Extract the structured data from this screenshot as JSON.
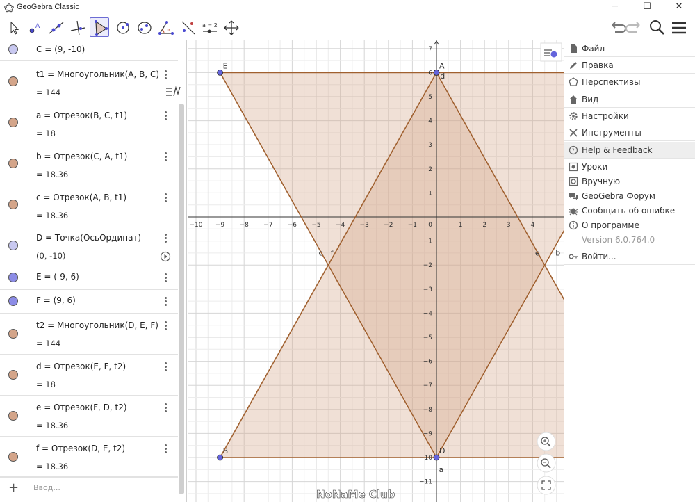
{
  "window": {
    "title": "GeoGebra Classic",
    "minimize": "─",
    "maximize": "☐",
    "close": "✕"
  },
  "toolbar": {
    "tools": [
      "move-tool",
      "point-tool",
      "line-tool",
      "perpendicular-tool",
      "polygon-tool",
      "circle-tool",
      "conic-tool",
      "angle-tool",
      "reflect-tool",
      "slider-tool",
      "move-graphics-tool"
    ],
    "slider_label": "a = 2",
    "active_tool": "polygon-tool"
  },
  "algebra": {
    "rows": [
      {
        "def": "C = (9, -10)",
        "value": "",
        "marble": "#c8c8f0"
      },
      {
        "def": "t1 = Многоугольник(A, B, C)",
        "value": "= 144",
        "marble": "#d4a58a"
      },
      {
        "def": "a = Отрезок(B, C, t1)",
        "value": "= 18",
        "marble": "#d4a58a"
      },
      {
        "def": "b = Отрезок(C, A, t1)",
        "value": "= 18.36",
        "marble": "#d4a58a"
      },
      {
        "def": "c = Отрезок(A, B, t1)",
        "value": "= 18.36",
        "marble": "#d4a58a"
      },
      {
        "def": "D = Точка(ОсьОрдинат)",
        "value": "(0, -10)",
        "marble": "#c8c8f0"
      },
      {
        "def": "E = (-9, 6)",
        "value": "",
        "marble": "#8c8ce6"
      },
      {
        "def": "F = (9, 6)",
        "value": "",
        "marble": "#8c8ce6"
      },
      {
        "def": "t2 = Многоугольник(D, E, F)",
        "value": "= 144",
        "marble": "#d4a58a"
      },
      {
        "def": "d = Отрезок(E, F, t2)",
        "value": "= 18",
        "marble": "#d4a58a"
      },
      {
        "def": "e = Отрезок(F, D, t2)",
        "value": "= 18.36",
        "marble": "#d4a58a"
      },
      {
        "def": "f = Отрезок(D, E, t2)",
        "value": "= 18.36",
        "marble": "#d4a58a"
      }
    ],
    "input_placeholder": "Ввод..."
  },
  "graphics": {
    "x_ticks": [
      -10,
      -9,
      -8,
      -7,
      -6,
      -5,
      -4,
      -3,
      -2,
      -1,
      1,
      2,
      3,
      4
    ],
    "y_ticks": [
      7,
      6,
      5,
      4,
      3,
      2,
      1,
      -1,
      -2,
      -3,
      -4,
      -5,
      -6,
      -7,
      -8,
      -9,
      -10,
      -11
    ],
    "origin_label": "0",
    "point_labels": {
      "A": "A",
      "B": "B",
      "E": "E",
      "D": "D"
    },
    "segment_labels": {
      "a": "a",
      "b": "b",
      "c": "c",
      "d": "d",
      "e": "e",
      "f": "f"
    },
    "watermark": "NoNaMe Club",
    "shape_fill": "#d4a58a",
    "shape_stroke": "#a0602f",
    "point_color": "#6464dc"
  },
  "menu": {
    "items": [
      {
        "label": "Файл",
        "icon": "file-icon"
      },
      {
        "label": "Правка",
        "icon": "pencil-icon"
      },
      {
        "label": "Перспективы",
        "icon": "perspectives-icon"
      },
      {
        "label": "Вид",
        "icon": "home-icon"
      },
      {
        "label": "Настройки",
        "icon": "gear-icon"
      },
      {
        "label": "Инструменты",
        "icon": "tools-icon"
      },
      {
        "label": "Help & Feedback",
        "icon": "help-icon"
      }
    ],
    "sub_items": [
      {
        "label": "Уроки",
        "icon": "tutorial-icon"
      },
      {
        "label": "Вручную",
        "icon": "manual-icon"
      },
      {
        "label": "GeoGebra Форум",
        "icon": "forum-icon"
      },
      {
        "label": "Сообщить об ошибке",
        "icon": "bug-icon"
      },
      {
        "label": "О программе",
        "icon": "info-icon"
      }
    ],
    "version": "Version 6.0.764.0",
    "sign_in": "Войти..."
  }
}
